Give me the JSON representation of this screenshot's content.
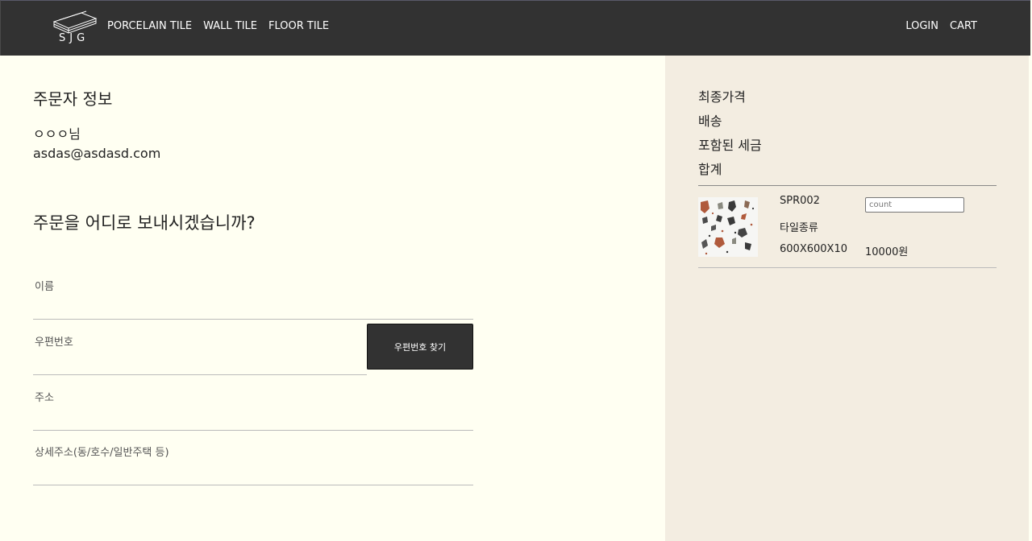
{
  "header": {
    "logo_text": "SJG",
    "nav": [
      "PORCELAIN TILE",
      "WALL TILE",
      "FLOOR TILE"
    ],
    "login_label": "LOGIN",
    "cart_label": "CART"
  },
  "orderer": {
    "title": "주문자 정보",
    "name": "ㅇㅇㅇ님",
    "email": "asdas@asdasd.com"
  },
  "shipping": {
    "title": "주문을 어디로 보내시겠습니까?",
    "name_label": "이름",
    "zip_label": "우편번호",
    "zip_button": "우편번호 찾기",
    "address_label": "주소",
    "detail_label": "상세주소(동/호수/일반주택 등)"
  },
  "summary": {
    "final_price": "최종가격",
    "shipping": "배송",
    "tax_included": "포함된 세금",
    "total": "합계"
  },
  "cart_item": {
    "code": "SPR002",
    "count_placeholder": "count",
    "type": "타일종류",
    "size": "600X600X10",
    "price": "10000원"
  },
  "colors": {
    "header_bg": "#323232",
    "page_bg": "#fffff2",
    "panel_bg": "#f3ede1",
    "button_bg": "#323232"
  },
  "icons": [
    "tile-stack-logo-icon"
  ]
}
